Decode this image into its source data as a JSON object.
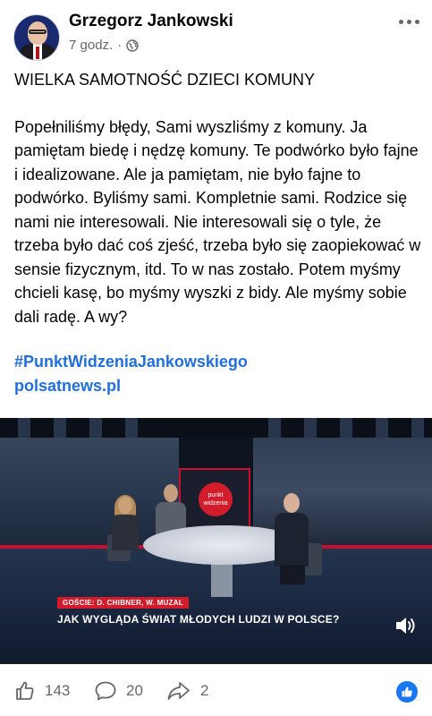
{
  "post": {
    "author": "Grzegorz Jankowski",
    "time": "7 godz.",
    "separator": "·",
    "title": "WIELKA SAMOTNOŚĆ DZIECI KOMUNY",
    "body": "Popełniliśmy błędy, Sami wyszliśmy z komuny. Ja pamiętam biedę i nędzę komuny. Te podwórko było fajne i idealizowane. Ale ja pamiętam, nie było fajne to podwórko. Byliśmy sami. Kompletnie sami. Rodzice się nami nie interesowali. Nie interesowali się o tyle, że trzeba było dać coś zjeść, trzeba było się zaopiekować w sensie fizycznym, itd. To w nas zostało. Potem myśmy chcieli kasę, bo myśmy wyszki z bidy. Ale myśmy sobie dali radę. A wy?",
    "hashtag": "#PunktWidzeniaJankowskiego",
    "link": "polsatnews.pl"
  },
  "video": {
    "guests_label": "GOŚCIE: D. CHIBNER, W. MUZAL",
    "headline": "JAK WYGLĄDA ŚWIAT MŁODYCH LUDZI W POLSCE?",
    "screen_text": "punkt widzenia"
  },
  "actions": {
    "likes": "143",
    "comments": "20",
    "shares": "2"
  },
  "icons": {
    "privacy": "globe-icon",
    "more": "more-options-icon",
    "like": "thumbs-up-icon",
    "comment": "comment-bubble-icon",
    "share": "share-arrow-icon",
    "sound": "speaker-icon",
    "reaction": "like-reaction-icon"
  },
  "colors": {
    "link": "#216fdb",
    "accent": "#1877f2",
    "broadcast_red": "#d21c2c"
  }
}
